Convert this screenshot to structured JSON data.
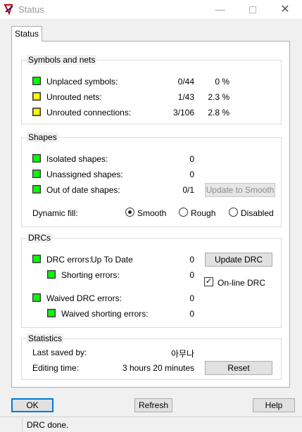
{
  "window": {
    "title": "Status",
    "minimize": "—",
    "close": "✕"
  },
  "tabs": [
    "Status"
  ],
  "symbols_nets": {
    "title": "Symbols and nets",
    "rows": [
      {
        "label": "Unplaced symbols:",
        "count": "0/44",
        "percent": "0 %",
        "color": "#00ff00"
      },
      {
        "label": "Unrouted nets:",
        "count": "1/43",
        "percent": "2.3 %",
        "color": "#ffff00"
      },
      {
        "label": "Unrouted connections:",
        "count": "3/106",
        "percent": "2.8 %",
        "color": "#ffff00"
      }
    ]
  },
  "shapes": {
    "title": "Shapes",
    "rows": [
      {
        "label": "Isolated shapes:",
        "count": "0",
        "color": "#00ff00"
      },
      {
        "label": "Unassigned shapes:",
        "count": "0",
        "color": "#00ff00"
      },
      {
        "label": "Out of date shapes:",
        "count": "0/1",
        "color": "#00ff00"
      }
    ],
    "update_button": "Update to Smooth",
    "dynamic_fill_label": "Dynamic fill:",
    "fill_options": [
      "Smooth",
      "Rough",
      "Disabled"
    ],
    "fill_selected": "Smooth"
  },
  "drcs": {
    "title": "DRCs",
    "drc_errors_label": "DRC errors:",
    "drc_status": "Up To Date",
    "drc_errors": "0",
    "shorting_label": "Shorting errors:",
    "shorting": "0",
    "waived_label": "Waived DRC errors:",
    "waived": "0",
    "waived_shorting_label": "Waived shorting errors:",
    "waived_shorting": "0",
    "update_button": "Update DRC",
    "online_label": "On-line DRC",
    "online_checked": true
  },
  "statistics": {
    "title": "Statistics",
    "last_saved_label": "Last saved by:",
    "last_saved_value": "아무나",
    "editing_label": "Editing time:",
    "editing_value": "3 hours 20 minutes",
    "reset_button": "Reset"
  },
  "footer": {
    "ok": "OK",
    "refresh": "Refresh",
    "help": "Help"
  },
  "status_bar": {
    "text": "DRC done."
  }
}
